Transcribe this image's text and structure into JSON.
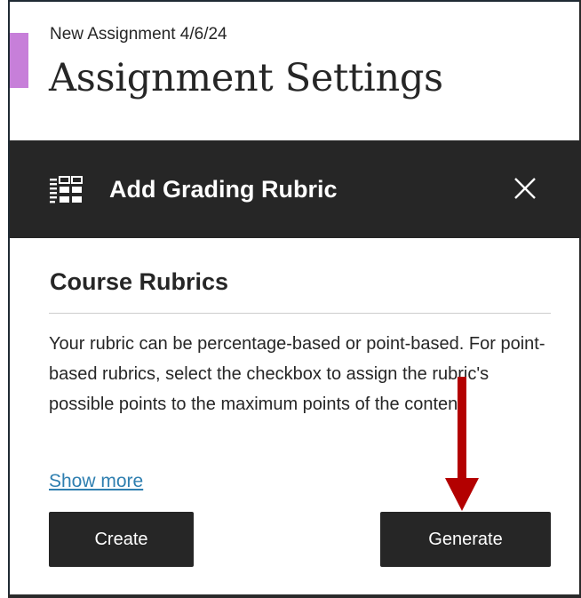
{
  "breadcrumb": "New Assignment 4/6/24",
  "page_title": "Assignment Settings",
  "panel": {
    "title": "Add Grading Rubric",
    "icon": "rubric-grid-icon",
    "close_icon": "close-icon"
  },
  "section": {
    "title": "Course Rubrics",
    "description": "Your rubric can be percentage-based or point-based. For point-based rubrics, select the checkbox to assign the rubric's possible points to the maximum points of the content.",
    "show_more": "Show more"
  },
  "buttons": {
    "create": "Create",
    "generate": "Generate"
  },
  "colors": {
    "header_bg": "#262626",
    "link": "#2f7fb0",
    "arrow": "#b30000",
    "accent_tab": "#c77fd9"
  }
}
